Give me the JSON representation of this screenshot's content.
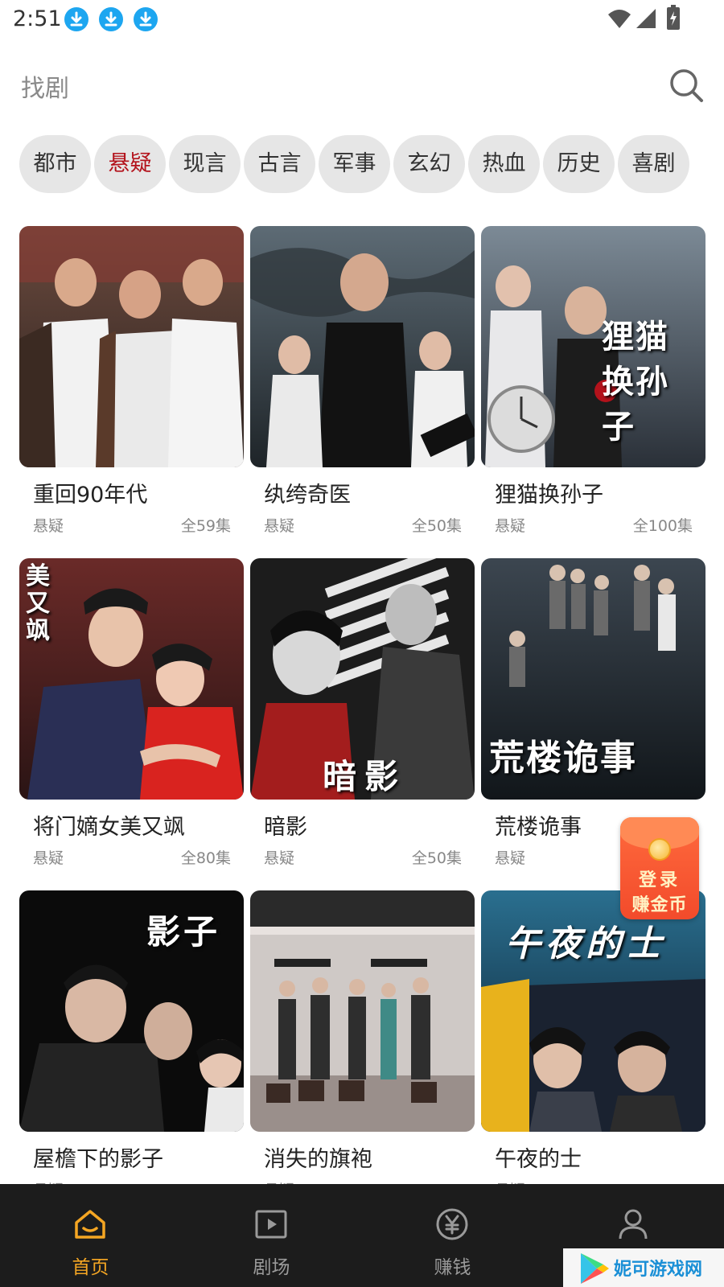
{
  "status_bar": {
    "time": "2:51",
    "download_icons": [
      "download-icon",
      "download-icon",
      "download-icon"
    ],
    "icons": [
      "wifi-icon",
      "signal-icon",
      "battery-charging-icon"
    ]
  },
  "search": {
    "placeholder": "找剧",
    "icon": "search-icon"
  },
  "categories": [
    {
      "label": "都市",
      "active": false
    },
    {
      "label": "悬疑",
      "active": true
    },
    {
      "label": "现言",
      "active": false
    },
    {
      "label": "古言",
      "active": false
    },
    {
      "label": "军事",
      "active": false
    },
    {
      "label": "玄幻",
      "active": false
    },
    {
      "label": "热血",
      "active": false
    },
    {
      "label": "历史",
      "active": false
    },
    {
      "label": "喜剧",
      "active": false
    }
  ],
  "dramas": [
    {
      "title": "重回90年代",
      "genre": "悬疑",
      "episodes": "全59集",
      "poster_text": ""
    },
    {
      "title": "纨绔奇医",
      "genre": "悬疑",
      "episodes": "全50集",
      "poster_text": ""
    },
    {
      "title": "狸猫换孙子",
      "genre": "悬疑",
      "episodes": "全100集",
      "poster_text": "狸猫换孙子"
    },
    {
      "title": "将门嫡女美又飒",
      "genre": "悬疑",
      "episodes": "全80集",
      "poster_text": "美又飒"
    },
    {
      "title": "暗影",
      "genre": "悬疑",
      "episodes": "全50集",
      "poster_text": "暗影"
    },
    {
      "title": "荒楼诡事",
      "genre": "悬疑",
      "episodes": "",
      "poster_text": "荒楼诡事"
    },
    {
      "title": "屋檐下的影子",
      "genre": "悬疑",
      "episodes": "",
      "poster_text": "影子"
    },
    {
      "title": "消失的旗袍",
      "genre": "悬疑",
      "episodes": "",
      "poster_text": ""
    },
    {
      "title": "午夜的士",
      "genre": "悬疑",
      "episodes": "",
      "poster_text": "午夜的士"
    }
  ],
  "promo": {
    "line1": "登录",
    "line2": "赚金币",
    "icon": "coin-icon"
  },
  "bottom_nav": [
    {
      "label": "首页",
      "icon": "home-icon",
      "active": true
    },
    {
      "label": "剧场",
      "icon": "play-icon",
      "active": false
    },
    {
      "label": "赚钱",
      "icon": "yen-coin-icon",
      "active": false
    },
    {
      "label": "",
      "icon": "profile-icon",
      "active": false
    }
  ],
  "watermark": {
    "text": "妮可游戏网",
    "icon": "play-store-logo-icon"
  },
  "colors": {
    "accent": "#f5a623",
    "active_chip_text": "#b3121b",
    "chip_bg": "#e6e6e6",
    "nav_bg": "#1c1c1c",
    "download_blue": "#1da6f0"
  }
}
